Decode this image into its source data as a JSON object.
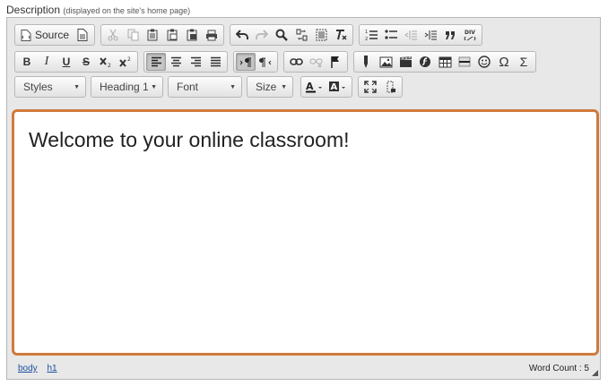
{
  "field": {
    "label": "Description",
    "hint": "(displayed on the site's home page)"
  },
  "toolbar": {
    "source_label": "Source",
    "bold_label": "B",
    "italic_label": "I",
    "underline_label": "U",
    "strike_label": "S",
    "omega_label": "Ω",
    "sigma_label": "Σ",
    "styles_value": "Styles",
    "format_value": "Heading 1",
    "font_value": "Font",
    "size_value": "Size"
  },
  "content": {
    "text": "Welcome to your online classroom!"
  },
  "status": {
    "path": [
      "body",
      "h1"
    ],
    "word_count": "Word Count : 5"
  }
}
